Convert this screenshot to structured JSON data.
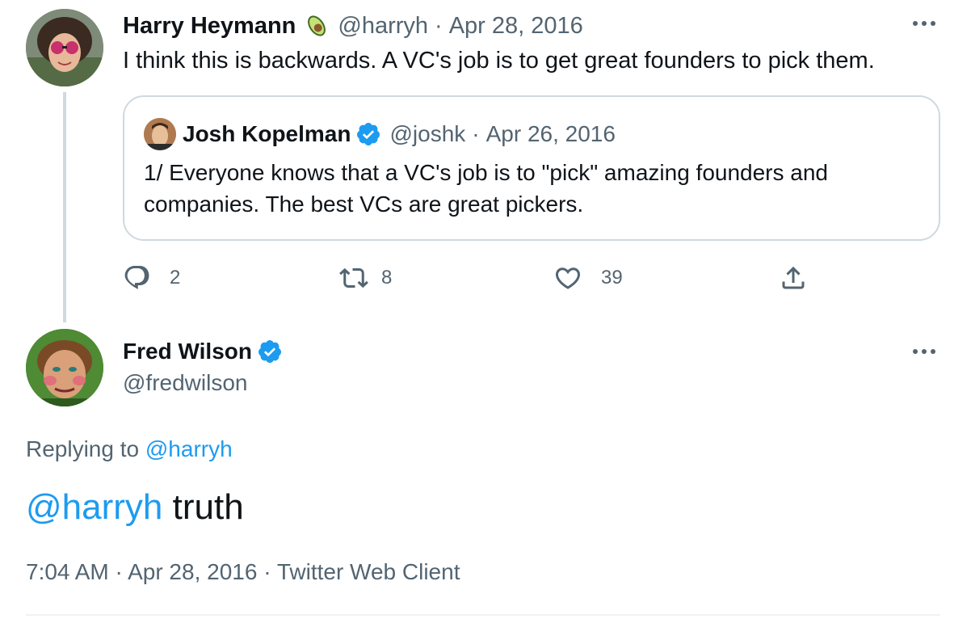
{
  "parent_tweet": {
    "author_name": "Harry Heymann",
    "author_badge_icon": "avocado-icon",
    "handle": "@harryh",
    "separator": "·",
    "date": "Apr 28, 2016",
    "text": "I think this is backwards. A VC's job is to get great founders to pick them.",
    "quoted_tweet": {
      "author_name": "Josh Kopelman",
      "verified": true,
      "handle": "@joshk",
      "separator": "·",
      "date": "Apr 26, 2016",
      "text": "1/ Everyone knows that a VC's job is to \"pick\" amazing founders and companies.  The best VCs are great pickers."
    },
    "actions": {
      "reply_count": "2",
      "retweet_count": "8",
      "like_count": "39"
    }
  },
  "main_tweet": {
    "author_name": "Fred Wilson",
    "verified": true,
    "handle": "@fredwilson",
    "replying_to_label": "Replying to",
    "replying_to_handle": "@harryh",
    "mention": "@harryh",
    "text": " truth",
    "time": "7:04 AM",
    "separator": "·",
    "date": "Apr 28, 2016",
    "source": "Twitter Web Client"
  },
  "colors": {
    "accent": "#1d9bf0",
    "text": "#0f1419",
    "muted": "#536471",
    "border": "#cfd9de"
  }
}
